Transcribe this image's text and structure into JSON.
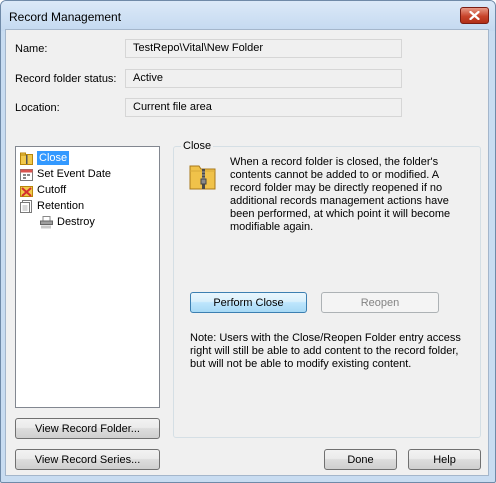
{
  "window": {
    "title": "Record Management"
  },
  "fields": {
    "name_label": "Name:",
    "name_value": "TestRepo\\Vital\\New Folder",
    "status_label": "Record folder status:",
    "status_value": "Active",
    "location_label": "Location:",
    "location_value": "Current file area"
  },
  "tree": {
    "items": [
      {
        "label": "Close",
        "icon": "folder-zipper-icon",
        "selected": true
      },
      {
        "label": "Set Event Date",
        "icon": "calendar-icon",
        "selected": false
      },
      {
        "label": "Cutoff",
        "icon": "cutoff-icon",
        "selected": false
      },
      {
        "label": "Retention",
        "icon": "retention-icon",
        "selected": false
      },
      {
        "label": "Destroy",
        "icon": "shredder-icon",
        "selected": false
      }
    ]
  },
  "panel": {
    "title": "Close",
    "description": "When a record folder is closed, the folder's contents cannot be added to or modified. A record folder may be directly reopened if no additional records management actions have been performed, at which point it will become modifiable again.",
    "perform_close_label": "Perform Close",
    "reopen_label": "Reopen",
    "note": "Note: Users with the Close/Reopen Folder entry access right will still be able to add content to the record folder, but will not be able to modify existing content."
  },
  "buttons": {
    "view_record_folder": "View Record Folder...",
    "view_record_series": "View Record Series...",
    "done": "Done",
    "help": "Help"
  },
  "colors": {
    "selection": "#3399ff",
    "close_button": "#c8442b",
    "title_bar": "#c4d9f0"
  }
}
